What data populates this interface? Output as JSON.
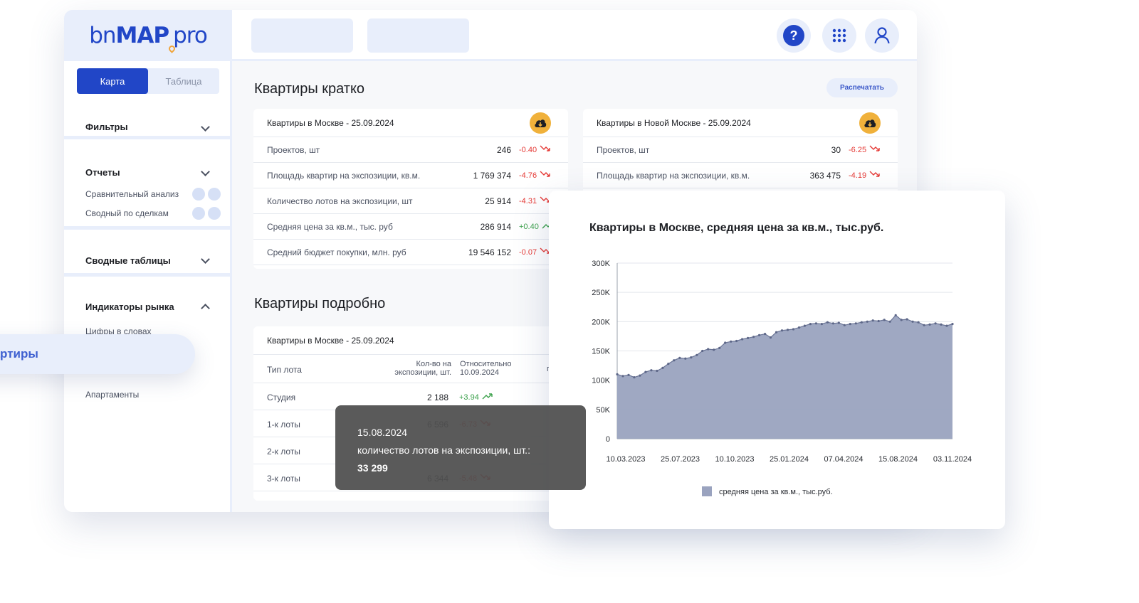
{
  "brand": {
    "logo_part1": "bn",
    "logo_part2": "MAP",
    "logo_part3": "pro"
  },
  "header": {
    "icons": [
      "help-icon",
      "apps-grid-icon",
      "user-icon"
    ],
    "help_glyph": "?"
  },
  "sidebar": {
    "view_toggle": {
      "map": "Карта",
      "table": "Таблица",
      "active": "map"
    },
    "filters": "Фильтры",
    "reports": {
      "title": "Отчеты",
      "items": [
        "Сравнительный анализ",
        "Сводный по сделкам"
      ]
    },
    "pivot_tables": "Сводные таблицы",
    "market": {
      "title": "Индикаторы рынка",
      "items": [
        "Цифры в словах",
        "Квартиры",
        "Апартаменты"
      ]
    }
  },
  "main": {
    "summary_title": "Квартиры кратко",
    "print_label": "Распечатать",
    "detail_title": "Квартиры подробно",
    "card_moscow": {
      "title": "Квартиры в Москве - 25.09.2024",
      "rows": [
        {
          "label": "Проектов, шт",
          "value": "246",
          "delta": "-0.40",
          "trend": "down"
        },
        {
          "label": "Площадь квартир на экспозиции, кв.м.",
          "value": "1 769 374",
          "delta": "-4.76",
          "trend": "down"
        },
        {
          "label": "Количество лотов на экспозиции, шт",
          "value": "25 914",
          "delta": "-4.31",
          "trend": "down"
        },
        {
          "label": "Средняя цена за кв.м., тыс. руб",
          "value": "286 914",
          "delta": "+0.40",
          "trend": "up"
        },
        {
          "label": "Средний бюджет покупки, млн. руб",
          "value": "19 546 152",
          "delta": "-0.07",
          "trend": "down"
        }
      ]
    },
    "card_new_moscow": {
      "title": "Квартиры в Новой Москве - 25.09.2024",
      "rows": [
        {
          "label": "Проектов, шт",
          "value": "30",
          "delta": "-6.25",
          "trend": "down"
        },
        {
          "label": "Площадь квартир на экспозиции, кв.м.",
          "value": "363 475",
          "delta": "-4.19",
          "trend": "down"
        }
      ]
    },
    "detail_card": {
      "title": "Квартиры в Москве - 25.09.2024",
      "col_type": "Тип лота",
      "col_count": "Кол-во на экспозиции, шт.",
      "col_rel": "Относительно 10.09.2024",
      "col_extra": "г",
      "rows": [
        {
          "type": "Студия",
          "count": "2 188",
          "delta": "+3.94",
          "trend": "up"
        },
        {
          "type": "1-к лоты",
          "count": "6 596",
          "delta": "-6.73",
          "trend": "down"
        },
        {
          "type": "2-к лоты",
          "count": "",
          "delta": "",
          "trend": ""
        },
        {
          "type": "3-к лоты",
          "count": "6 344",
          "delta": "-5.48",
          "trend": "down"
        }
      ]
    }
  },
  "tooltip": {
    "date": "15.08.2024",
    "label": "количество лотов на экспозиции, шт.:",
    "value": "33 299"
  },
  "colors": {
    "brand_blue": "#2146c7",
    "accent_orange": "#f0b13b",
    "light_blue": "#e8eefb",
    "area": "#9aa3bf",
    "negative": "#e53935",
    "positive": "#3aa04a"
  },
  "chart_data": {
    "type": "area",
    "title": "Квартиры в Москве, средняя цена за кв.м., тыс.руб.",
    "x_ticks": [
      "10.03.2023",
      "25.07.2023",
      "10.10.2023",
      "25.01.2024",
      "07.04.2024",
      "15.08.2024",
      "03.11.2024"
    ],
    "y_ticks": [
      "0",
      "50K",
      "100K",
      "150K",
      "200K",
      "250K",
      "300K"
    ],
    "ylim": [
      0,
      300000
    ],
    "series": [
      {
        "name": "средняя цена за кв.м., тыс.руб.",
        "values": [
          110000,
          107000,
          109000,
          105000,
          108000,
          114000,
          117000,
          116000,
          121000,
          128000,
          134000,
          138000,
          137000,
          139000,
          143000,
          150000,
          153000,
          152000,
          155000,
          164000,
          166000,
          167000,
          170000,
          172000,
          174000,
          177000,
          179000,
          173000,
          182000,
          185000,
          186000,
          187000,
          190000,
          193000,
          196000,
          197000,
          196000,
          199000,
          197000,
          198000,
          194000,
          196000,
          197000,
          199000,
          200000,
          202000,
          201000,
          203000,
          200000,
          211000,
          203000,
          204000,
          200000,
          199000,
          194000,
          195000,
          197000,
          195000,
          193000,
          196000
        ]
      }
    ],
    "legend": "bottom",
    "grid": true
  }
}
